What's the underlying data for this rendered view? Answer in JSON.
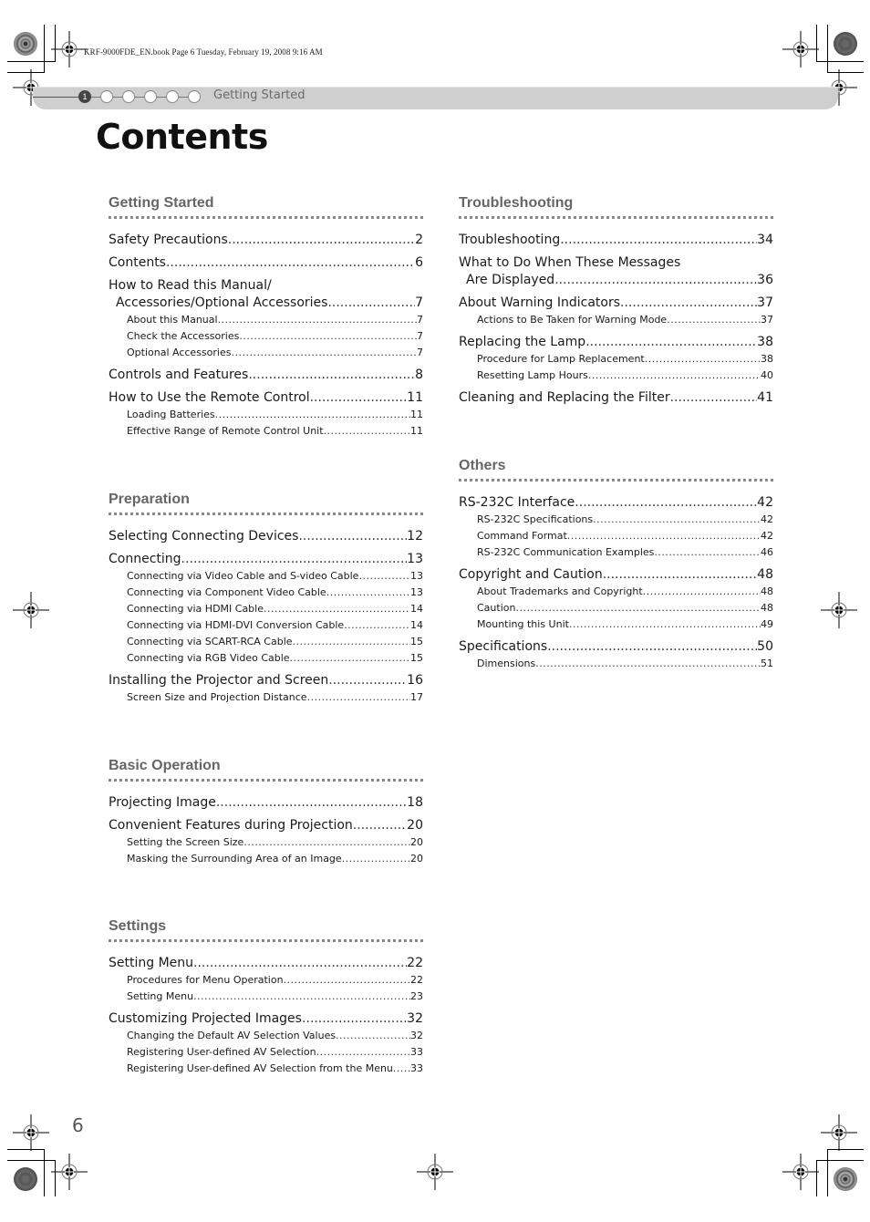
{
  "slug": "KRF-9000FDE_EN.book  Page 6  Tuesday, February 19, 2008  9:16 AM",
  "header": {
    "chapter_number": "1",
    "step_count": 6,
    "active_step": 1,
    "chapter_label": "Getting Started"
  },
  "title": "Contents",
  "page_number": "6",
  "sections": {
    "getting_started": {
      "heading": "Getting Started",
      "entries": [
        {
          "title": "Safety Precautions",
          "page": "2",
          "level": 1
        },
        {
          "title": "Contents",
          "page": "6",
          "level": 1
        },
        {
          "title_line1": "How to Read this Manual/",
          "title": "Accessories/Optional Accessories",
          "page": "7",
          "level": 1
        },
        {
          "title": "About this Manual",
          "page": "7",
          "level": 2
        },
        {
          "title": "Check the Accessories",
          "page": "7",
          "level": 2
        },
        {
          "title": "Optional Accessories",
          "page": "7",
          "level": 2
        },
        {
          "title": "Controls and Features ",
          "page": "8",
          "level": 1
        },
        {
          "title": "How to Use the Remote Control",
          "page": "11",
          "level": 1
        },
        {
          "title": "Loading Batteries",
          "page": "11",
          "level": 2
        },
        {
          "title": "Effective Range of Remote Control Unit",
          "page": "11",
          "level": 2
        }
      ]
    },
    "preparation": {
      "heading": "Preparation",
      "entries": [
        {
          "title": "Selecting Connecting Devices",
          "page": "12",
          "level": 1
        },
        {
          "title": "Connecting",
          "page": "13",
          "level": 1
        },
        {
          "title": "Connecting via Video Cable and S-video Cable",
          "page": "13",
          "level": 2
        },
        {
          "title": "Connecting via Component Video Cable ",
          "page": "13",
          "level": 2
        },
        {
          "title": "Connecting via HDMI Cable ",
          "page": "14",
          "level": 2
        },
        {
          "title": "Connecting via HDMI-DVI Conversion Cable ",
          "page": "14",
          "level": 2
        },
        {
          "title": "Connecting via SCART-RCA Cable",
          "page": "15",
          "level": 2
        },
        {
          "title": "Connecting via RGB Video Cable ",
          "page": "15",
          "level": 2
        },
        {
          "title": "Installing the Projector and Screen",
          "page": "16",
          "level": 1
        },
        {
          "title": "Screen Size and Projection Distance",
          "page": "17",
          "level": 2
        }
      ]
    },
    "basic_operation": {
      "heading": "Basic Operation",
      "entries": [
        {
          "title": "Projecting Image",
          "page": "18",
          "level": 1
        },
        {
          "title": "Convenient Features during Projection ",
          "page": "20",
          "level": 1
        },
        {
          "title": "Setting the Screen Size",
          "page": "20",
          "level": 2
        },
        {
          "title": "Masking the Surrounding Area of an Image ",
          "page": "20",
          "level": 2
        }
      ]
    },
    "settings": {
      "heading": "Settings",
      "entries": [
        {
          "title": "Setting Menu ",
          "page": "22",
          "level": 1
        },
        {
          "title": "Procedures for Menu Operation ",
          "page": "22",
          "level": 2
        },
        {
          "title": "Setting Menu",
          "page": "23",
          "level": 2
        },
        {
          "title": "Customizing Projected Images ",
          "page": "32",
          "level": 1
        },
        {
          "title": "Changing the Default AV Selection Values ",
          "page": "32",
          "level": 2
        },
        {
          "title": "Registering User-defined AV Selection",
          "page": "33",
          "level": 2
        },
        {
          "title": "Registering User-defined AV Selection from the Menu ",
          "page": "33",
          "level": 2
        }
      ]
    },
    "troubleshooting": {
      "heading": "Troubleshooting",
      "entries": [
        {
          "title": "Troubleshooting",
          "page": "34",
          "level": 1
        },
        {
          "title_line1": "What to Do When These Messages",
          "title": "Are Displayed ",
          "page": "36",
          "level": 1
        },
        {
          "title": "About Warning Indicators",
          "page": "37",
          "level": 1
        },
        {
          "title": "Actions to Be Taken for Warning Mode ",
          "page": "37",
          "level": 2
        },
        {
          "title": "Replacing the Lamp ",
          "page": "38",
          "level": 1
        },
        {
          "title": "Procedure for Lamp Replacement ",
          "page": "38",
          "level": 2
        },
        {
          "title": "Resetting Lamp Hours ",
          "page": "40",
          "level": 2
        },
        {
          "title": "Cleaning and Replacing the Filter",
          "page": "41",
          "level": 1
        }
      ]
    },
    "others": {
      "heading": "Others",
      "entries": [
        {
          "title": "RS-232C Interface ",
          "page": "42",
          "level": 1
        },
        {
          "title": "RS-232C Specifications ",
          "page": "42",
          "level": 2
        },
        {
          "title": "Command Format ",
          "page": "42",
          "level": 2
        },
        {
          "title": "RS-232C Communication Examples",
          "page": "46",
          "level": 2
        },
        {
          "title": "Copyright and Caution",
          "page": "48",
          "level": 1
        },
        {
          "title": "About Trademarks and Copyright ",
          "page": "48",
          "level": 2
        },
        {
          "title": "Caution ",
          "page": "48",
          "level": 2
        },
        {
          "title": "Mounting this Unit",
          "page": "49",
          "level": 2
        },
        {
          "title": "Specifications ",
          "page": "50",
          "level": 1
        },
        {
          "title": "Dimensions",
          "page": "51",
          "level": 2
        }
      ]
    }
  }
}
